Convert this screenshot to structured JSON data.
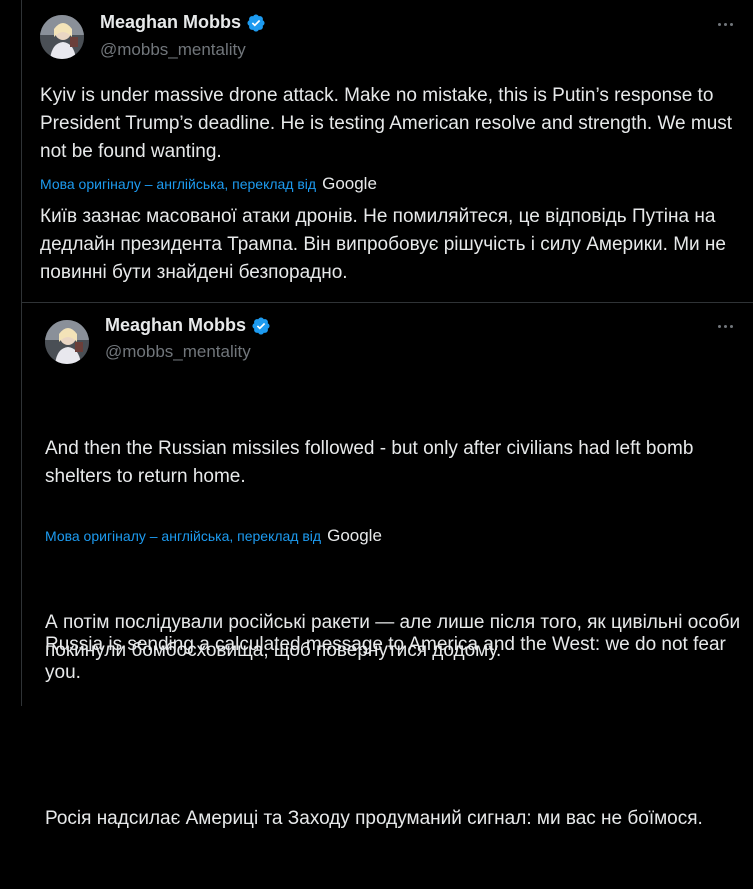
{
  "tweets": [
    {
      "author": {
        "name": "Meaghan Mobbs",
        "handle": "@mobbs_mentality"
      },
      "text": "Kyiv is under massive drone attack. Make no mistake, this is Putin’s response to President Trump’s deadline. He is testing American resolve and strength. We must not be found wanting.",
      "translation_label": "Мова оригіналу – англійська, переклад від",
      "translation_provider": "Google",
      "translation": "Київ зазнає масованої атаки дронів. Не помиляйтеся, це відповідь Путіна на дедлайн президента Трампа. Він випробовує рішучість і силу Америки. Ми не повинні бути знайдені безпорадно."
    },
    {
      "author": {
        "name": "Meaghan Mobbs",
        "handle": "@mobbs_mentality"
      },
      "text_p1": "And then the Russian missiles followed - but only after civilians had left bomb shelters to return home.",
      "text_p2": "Russia is sending a calculated message to America and the West: we do not fear you.",
      "translation_label": "Мова оригіналу – англійська, переклад від",
      "translation_provider": "Google",
      "translation_p1": "А потім послідували російські ракети — але лише після того, як цивільні особи покинули бомбосховища, щоб повернутися додому.",
      "translation_p2": "Росія надсилає Америці та Заходу продуманий сигнал: ми вас не боїмося."
    }
  ],
  "colors": {
    "background": "#000000",
    "text": "#e7e9ea",
    "secondary": "#71767b",
    "link": "#1d9bf0",
    "verified": "#1d9bf0",
    "divider": "#2f3336"
  },
  "icons": [
    "avatar",
    "verified-badge-icon",
    "more-options-icon"
  ]
}
